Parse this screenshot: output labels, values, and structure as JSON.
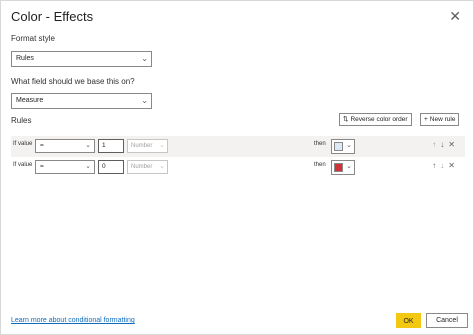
{
  "dialog": {
    "title": "Color - Effects",
    "close_icon": "close-icon"
  },
  "format_style": {
    "label": "Format style",
    "value": "Rules"
  },
  "base_field": {
    "label": "What field should we base this on?",
    "value": "Measure"
  },
  "rules": {
    "label": "Rules",
    "reverse_button": "Reverse color order",
    "new_rule_button": "New rule",
    "items": [
      {
        "if_label": "If value",
        "operator": "=",
        "value": "1",
        "type": "Number",
        "then_label": "then",
        "color": "#dce9f7"
      },
      {
        "if_label": "If value",
        "operator": "=",
        "value": "0",
        "type": "Number",
        "then_label": "then",
        "color": "#d13438"
      }
    ]
  },
  "footer": {
    "learn_link": "Learn more about conditional formatting",
    "ok_button": "OK",
    "cancel_button": "Cancel"
  }
}
